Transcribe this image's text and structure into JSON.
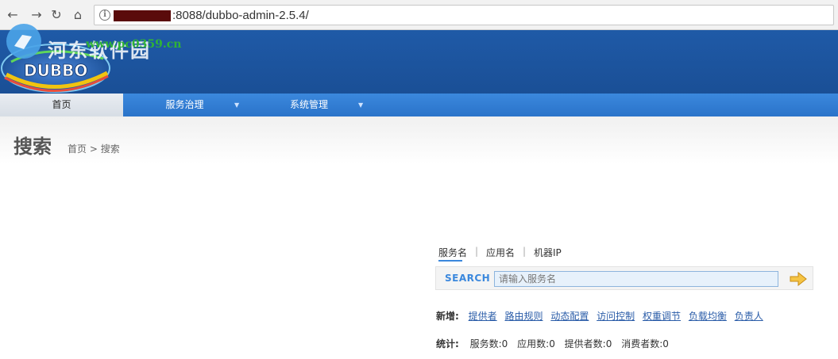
{
  "browser": {
    "url_suffix": ":8088/dubbo-admin-2.5.4/"
  },
  "header": {
    "logo_text": "DUBBO",
    "watermark_site": "河东软件园",
    "watermark_url": "www.pc0359.cn"
  },
  "nav": {
    "items": [
      {
        "label": "首页"
      },
      {
        "label": "服务治理"
      },
      {
        "label": "系统管理"
      }
    ]
  },
  "page": {
    "title": "搜索",
    "breadcrumb_home": "首页",
    "breadcrumb_sep": ">",
    "breadcrumb_current": "搜索"
  },
  "search": {
    "tabs": [
      {
        "label": "服务名"
      },
      {
        "label": "应用名"
      },
      {
        "label": "机器IP"
      }
    ],
    "label": "SEARCH",
    "placeholder": "请输入服务名"
  },
  "add": {
    "label": "新增:",
    "links": [
      {
        "label": "提供者"
      },
      {
        "label": "路由规则"
      },
      {
        "label": "动态配置"
      },
      {
        "label": "访问控制"
      },
      {
        "label": "权重调节"
      },
      {
        "label": "负载均衡"
      },
      {
        "label": "负责人"
      }
    ]
  },
  "stats": {
    "label": "统计:",
    "items": [
      {
        "text": "服务数:0"
      },
      {
        "text": "应用数:0"
      },
      {
        "text": "提供者数:0"
      },
      {
        "text": "消费者数:0"
      }
    ]
  },
  "colors": {
    "header_blue": "#1f5aa7",
    "nav_blue": "#3b88dd",
    "link_blue": "#2a5ca8"
  }
}
